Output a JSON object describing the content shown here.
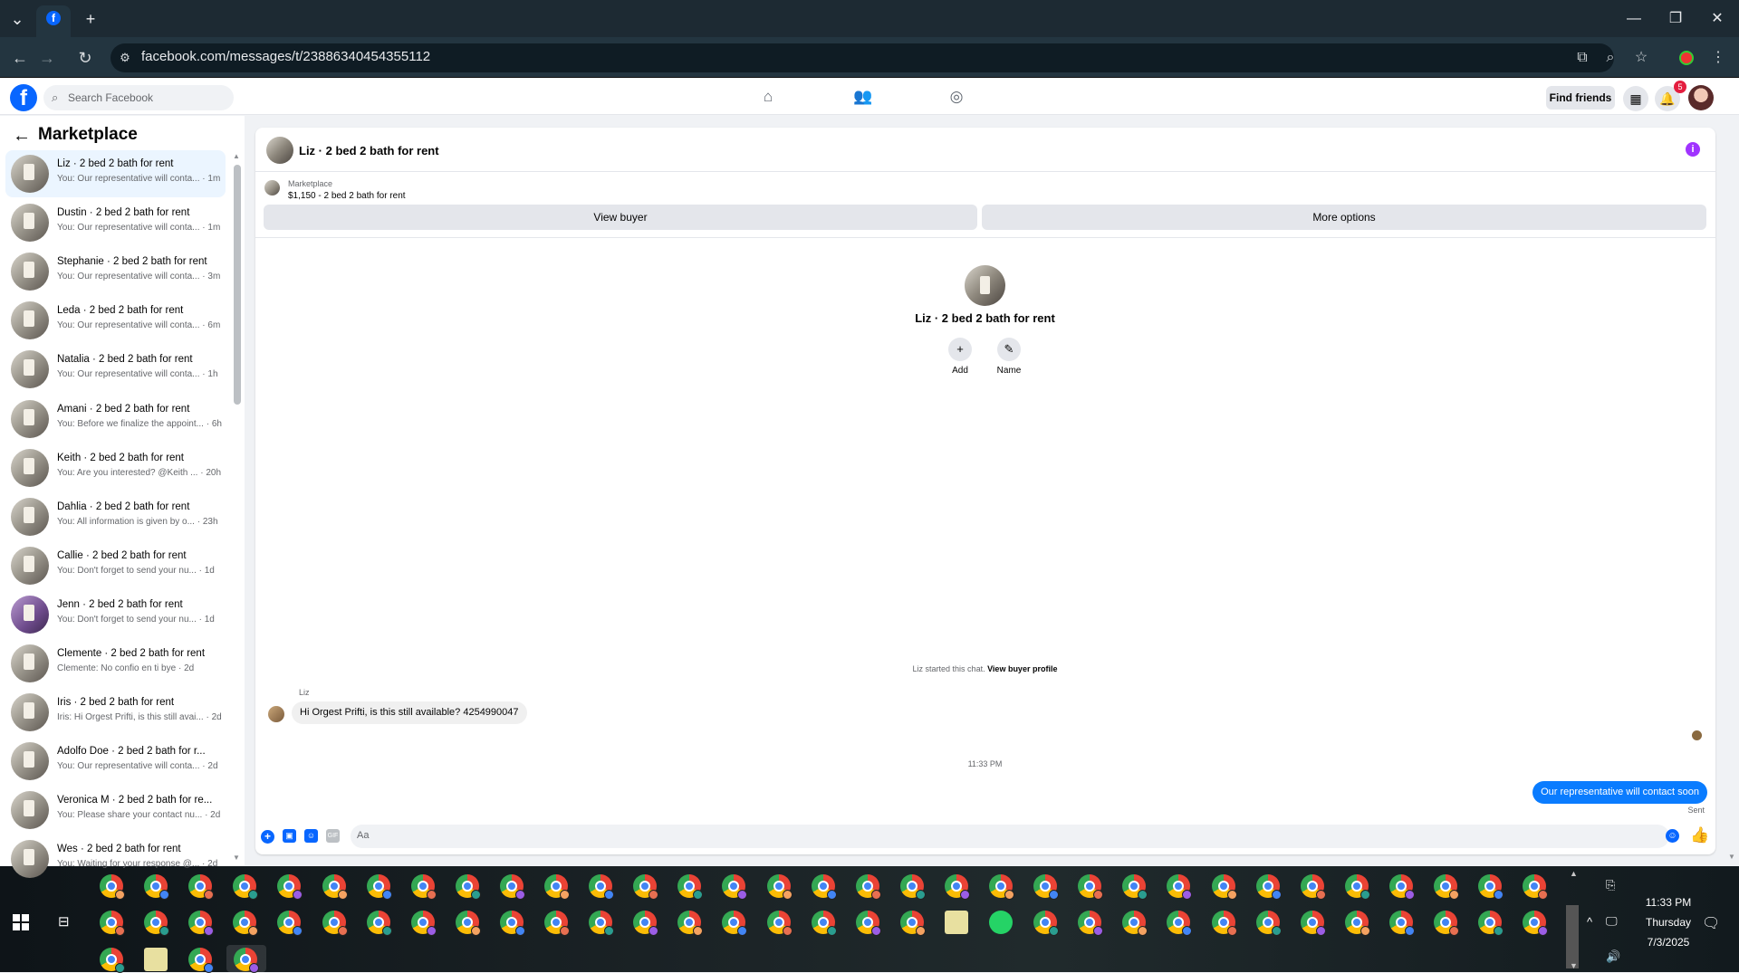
{
  "browser": {
    "url": "facebook.com/messages/t/23886340454355112",
    "new_tab_label": "+",
    "window_controls": [
      "—",
      "❐",
      "✕"
    ]
  },
  "fb_nav": {
    "search_placeholder": "Search Facebook",
    "find_friends_label": "Find friends",
    "notification_count": "5"
  },
  "sidebar": {
    "title": "Marketplace",
    "conversations": [
      {
        "name": "Liz · 2 bed 2 bath for rent",
        "snippet": "You: Our representative will conta... · 1m",
        "active": true
      },
      {
        "name": "Dustin · 2 bed 2 bath for rent",
        "snippet": "You: Our representative will conta... · 1m"
      },
      {
        "name": "Stephanie · 2 bed 2 bath for rent",
        "snippet": "You: Our representative will conta... · 3m"
      },
      {
        "name": "Leda · 2 bed 2 bath for rent",
        "snippet": "You: Our representative will conta... · 6m"
      },
      {
        "name": "Natalia · 2 bed 2 bath for rent",
        "snippet": "You: Our representative will conta... · 1h"
      },
      {
        "name": "Amani · 2 bed 2 bath for rent",
        "snippet": "You: Before we finalize the appoint... · 6h"
      },
      {
        "name": "Keith · 2 bed 2 bath for rent",
        "snippet": "You: Are you interested? @Keith ... · 20h"
      },
      {
        "name": "Dahlia · 2 bed 2 bath for rent",
        "snippet": "You: All information is given by o... · 23h"
      },
      {
        "name": "Callie · 2 bed 2 bath for rent",
        "snippet": "You: Don't forget to send your nu... · 1d"
      },
      {
        "name": "Jenn · 2 bed 2 bath for rent",
        "snippet": "You: Don't forget to send your nu... · 1d"
      },
      {
        "name": "Clemente · 2 bed 2 bath for rent",
        "snippet": "Clemente: No confio en ti bye · 2d"
      },
      {
        "name": "Iris · 2 bed 2 bath for rent",
        "snippet": "Iris: Hi Orgest Prifti, is this still avai... · 2d"
      },
      {
        "name": "Adolfo Doe · 2 bed 2 bath for r...",
        "snippet": "You: Our representative will conta... · 2d"
      },
      {
        "name": "Veronica M · 2 bed 2 bath for re...",
        "snippet": "You: Please share your contact nu... · 2d"
      },
      {
        "name": "Wes · 2 bed 2 bath for rent",
        "snippet": "You: Waiting for your response @... · 2d"
      }
    ]
  },
  "chat": {
    "header_title": "Liz · 2 bed 2 bath for rent",
    "marketplace_label": "Marketplace",
    "listing": "$1,150 - 2 bed 2 bath for rent",
    "view_buyer_label": "View buyer",
    "more_options_label": "More options",
    "center_name": "Liz · 2 bed 2 bath for rent",
    "add_label": "Add",
    "name_label": "Name",
    "started_text": "Liz started this chat.",
    "view_buyer_profile": "View buyer profile",
    "sender_label": "Liz",
    "incoming_message": "Hi Orgest Prifti, is this still available? 4254990047",
    "timestamp": "11:33 PM",
    "outgoing_message": "Our representative will contact soon",
    "sent_label": "Sent",
    "composer_placeholder": "Aa"
  },
  "taskbar": {
    "time": "11:33 PM",
    "day": "Thursday",
    "date": "7/3/2025"
  },
  "colors": {
    "fb_blue": "#0866ff",
    "bubble_blue": "#0a7cff",
    "chrome_dark": "#233540"
  }
}
